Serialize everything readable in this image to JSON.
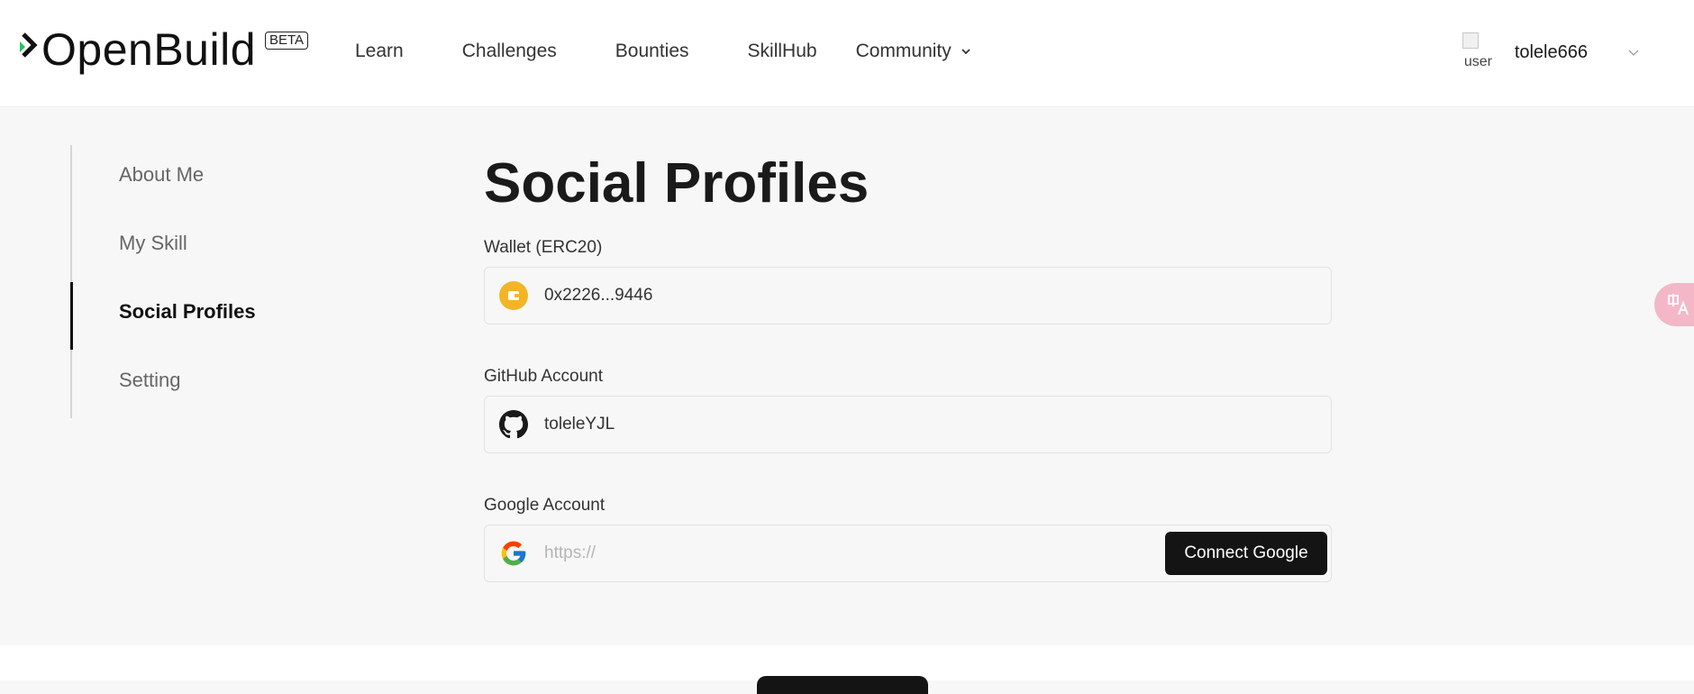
{
  "brand": {
    "name": "OpenBuild",
    "badge": "BETA",
    "accent_color": "#22c55e"
  },
  "nav": {
    "items": [
      {
        "label": "Learn"
      },
      {
        "label": "Challenges"
      },
      {
        "label": "Bounties"
      },
      {
        "label": "SkillHub"
      }
    ],
    "community_label": "Community"
  },
  "user": {
    "avatar_alt": "user",
    "name": "tolele666"
  },
  "sidebar": {
    "items": [
      {
        "label": "About Me"
      },
      {
        "label": "My Skill"
      },
      {
        "label": "Social Profiles",
        "active": true
      },
      {
        "label": "Setting"
      }
    ]
  },
  "main": {
    "title": "Social Profiles",
    "wallet": {
      "label": "Wallet (ERC20)",
      "value": "0x2226...9446",
      "icon": "wallet-icon"
    },
    "github": {
      "label": "GitHub Account",
      "value": "toleleYJL",
      "icon": "github-icon"
    },
    "google": {
      "label": "Google Account",
      "placeholder": "https://",
      "icon": "google-icon",
      "button_label": "Connect Google"
    }
  },
  "translate": {
    "icon": "translate-icon"
  }
}
